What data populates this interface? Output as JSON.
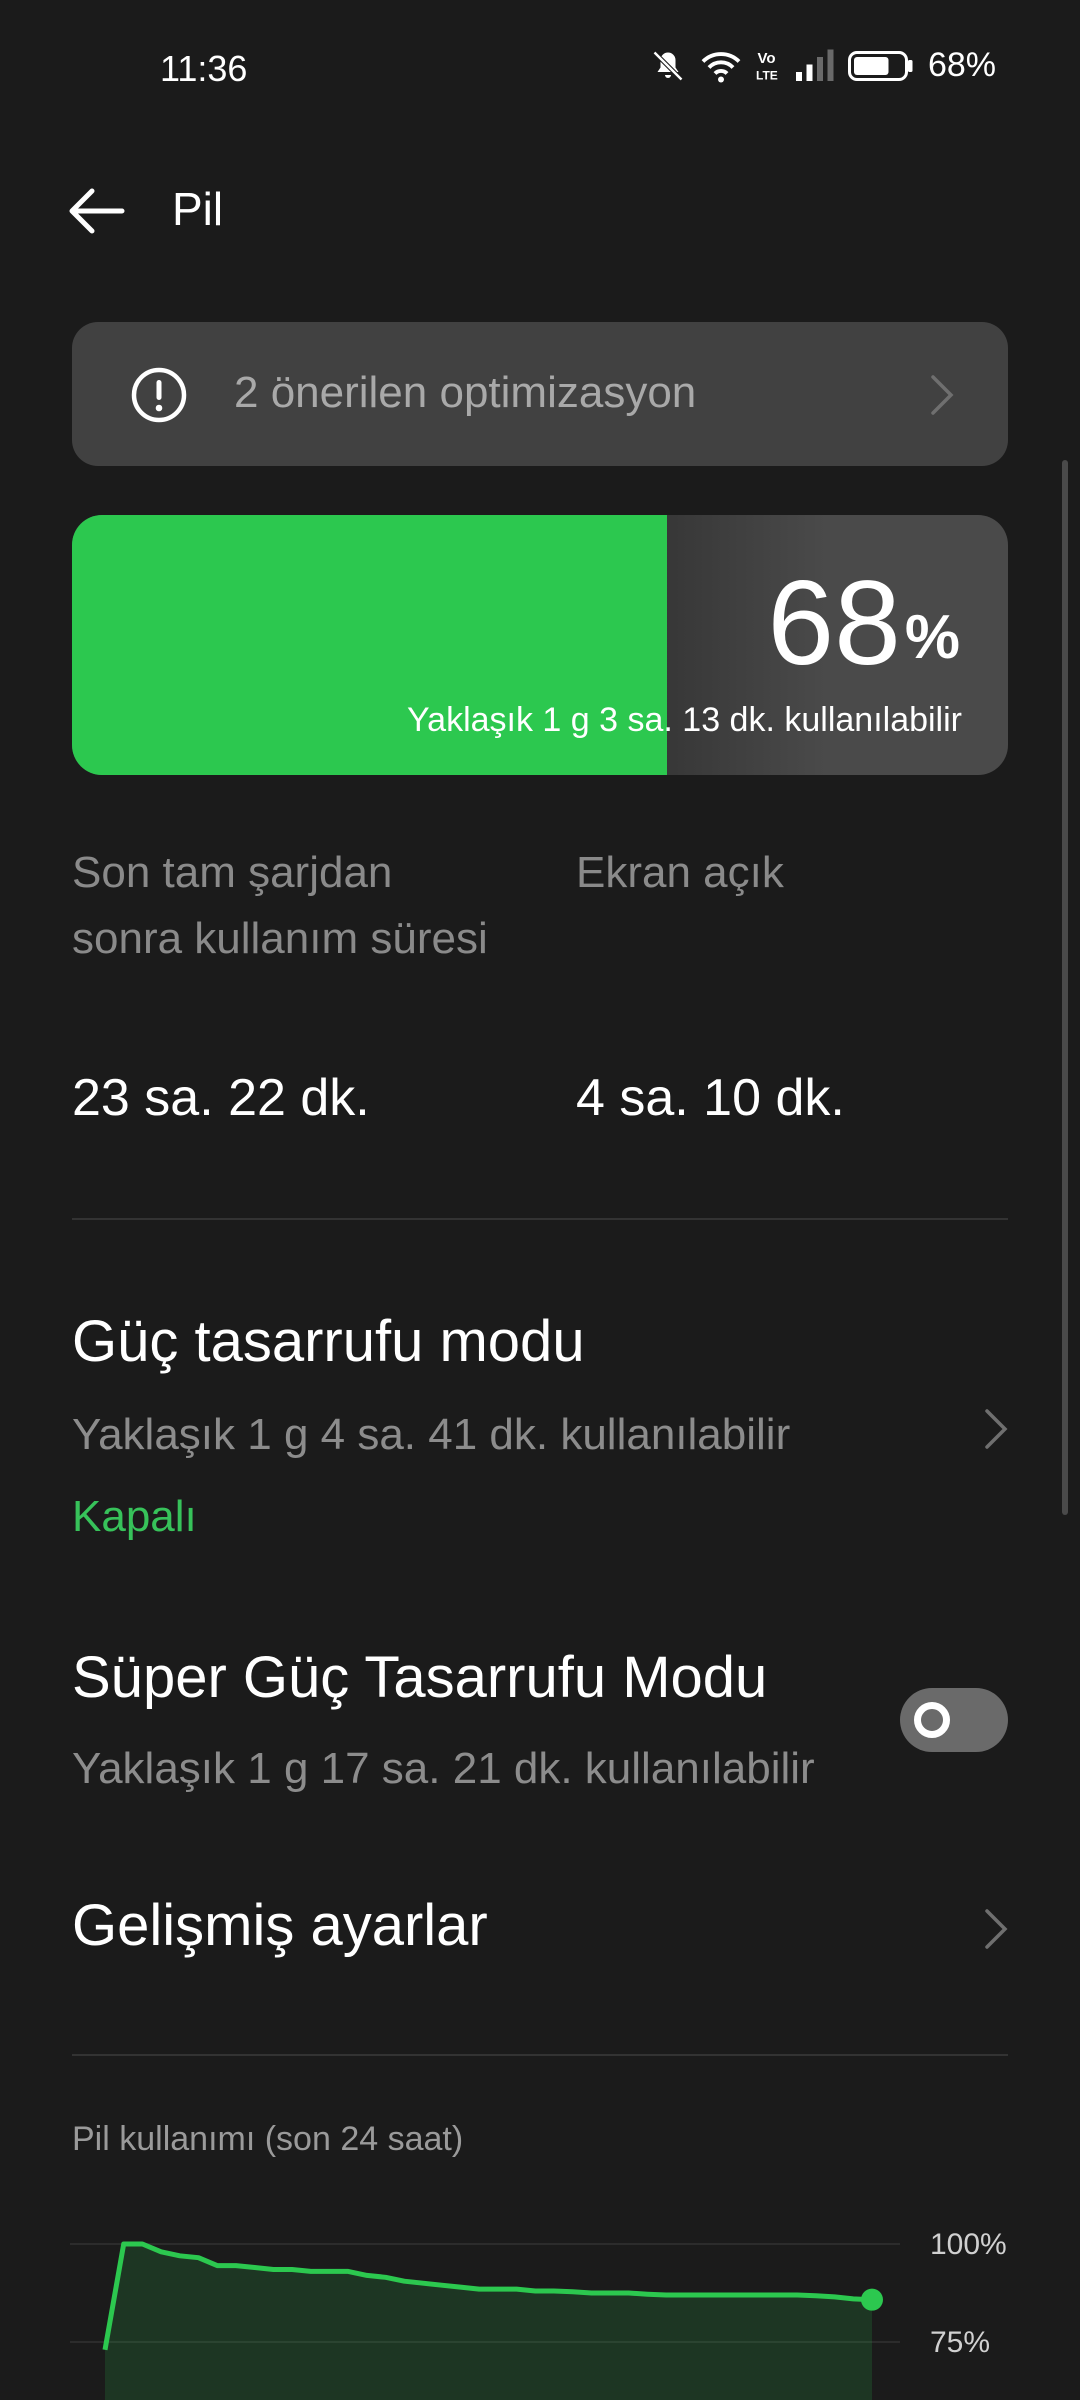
{
  "status_bar": {
    "time": "11:36",
    "battery_text": "68%",
    "icons": [
      "mute-icon",
      "wifi-icon",
      "volte-icon",
      "signal-icon",
      "battery-icon"
    ]
  },
  "header": {
    "title": "Pil"
  },
  "optimization": {
    "label": "2 önerilen optimizasyon"
  },
  "battery": {
    "level_number": "68",
    "level_unit": "%",
    "level_fraction": 0.68,
    "estimate": "Yaklaşık 1 g 3 sa. 13 dk. kullanılabilir",
    "fill_color": "#2cc84f"
  },
  "stats": {
    "since_charge_label": "Son tam şarjdan sonra kullanım süresi",
    "since_charge_value": "23 sa. 22 dk.",
    "screen_on_label": "Ekran açık",
    "screen_on_value": "4 sa. 10 dk."
  },
  "power_saving": {
    "title": "Güç tasarrufu modu",
    "subtitle": "Yaklaşık 1 g 4 sa. 41 dk. kullanılabilir",
    "state": "Kapalı"
  },
  "super_power_saving": {
    "title": "Süper Güç Tasarrufu Modu",
    "subtitle": "Yaklaşık 1 g 17 sa. 21 dk. kullanılabilir",
    "enabled": false
  },
  "advanced": {
    "title": "Gelişmiş ayarlar"
  },
  "usage_chart": {
    "title": "Pil kullanımı (son 24 saat)",
    "y_tick_top": "100%",
    "y_tick_mid": "75%"
  },
  "chart_data": {
    "type": "area",
    "y_ticks": [
      "100%",
      "75%"
    ],
    "ylim": [
      65,
      100
    ],
    "values": [
      73,
      100,
      100,
      98,
      97,
      96.5,
      94.5,
      94.5,
      94,
      93.5,
      93.5,
      93,
      93,
      93,
      92,
      91.5,
      90.5,
      90,
      89.5,
      89,
      88.5,
      88.5,
      88.5,
      88,
      88,
      87.8,
      87.5,
      87.5,
      87.5,
      87.2,
      87,
      87,
      87,
      87,
      87,
      87,
      87,
      87,
      86.8,
      86.5,
      86,
      85.8
    ],
    "color": "#2cc84f"
  }
}
